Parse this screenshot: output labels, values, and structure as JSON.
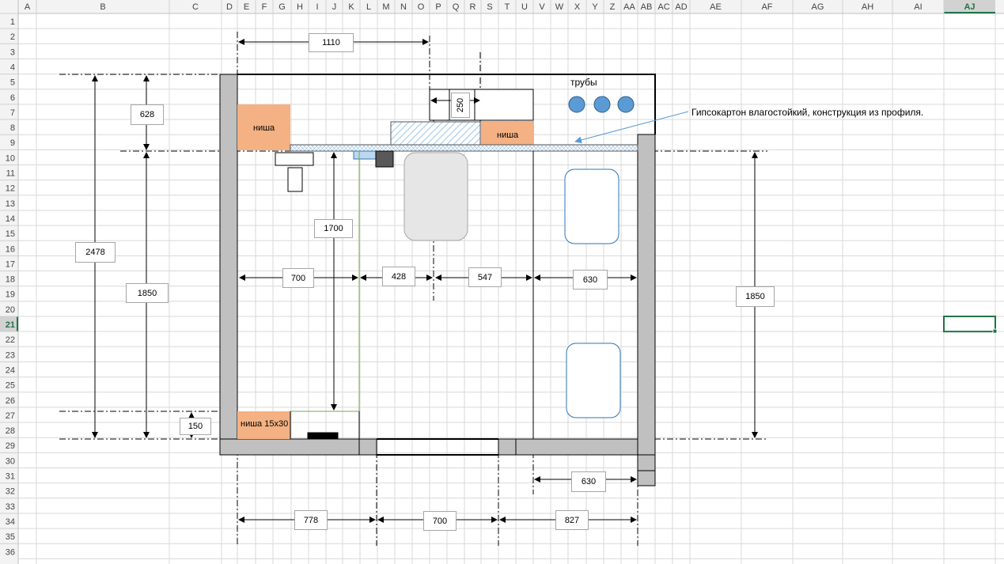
{
  "sheet": {
    "columns": [
      "A",
      "B",
      "C",
      "D",
      "E",
      "F",
      "G",
      "H",
      "I",
      "J",
      "K",
      "L",
      "M",
      "N",
      "O",
      "P",
      "Q",
      "R",
      "S",
      "T",
      "U",
      "V",
      "W",
      "X",
      "Y",
      "Z",
      "AA",
      "AB",
      "AC",
      "AD",
      "AE",
      "AF",
      "AG",
      "AH",
      "AI",
      "AJ"
    ],
    "rows": [
      "1",
      "2",
      "3",
      "4",
      "5",
      "6",
      "7",
      "8",
      "9",
      "10",
      "11",
      "12",
      "13",
      "14",
      "15",
      "16",
      "17",
      "18",
      "19",
      "20",
      "21",
      "22",
      "23",
      "24",
      "25",
      "26",
      "27",
      "28",
      "29",
      "30",
      "31",
      "32",
      "33",
      "34",
      "35",
      "36"
    ],
    "selected_column": "AJ",
    "selected_row": "21"
  },
  "colors": {
    "grid": "#d9d9d9",
    "header_bg": "#f3f3f3",
    "header_text": "#444444",
    "selection": "#217346",
    "wall": "#c0c0c0",
    "niche": "#f4b183",
    "hatch": "#9dc3e6",
    "pipe": "#5b9bd5",
    "green_line": "#70ad47"
  },
  "plan": {
    "dimensions": {
      "top_1110": "1110",
      "vertical_250": "250",
      "left_2478": "2478",
      "left_628": "628",
      "left_1850": "1850",
      "left_150": "150",
      "inner_1700": "1700",
      "horizontal_700": "700",
      "horizontal_428": "428",
      "horizontal_547": "547",
      "horizontal_630": "630",
      "right_1850": "1850",
      "below_630": "630",
      "bottom_778": "778",
      "bottom_700": "700",
      "bottom_827": "827"
    },
    "labels": {
      "pipes": "трубы",
      "niche_top_left": "ниша",
      "niche_top_right": "ниша",
      "niche_bottom": "ниша  15х30",
      "annotation": "Гипсокартон влагостойкий, конструкция из профиля."
    }
  }
}
